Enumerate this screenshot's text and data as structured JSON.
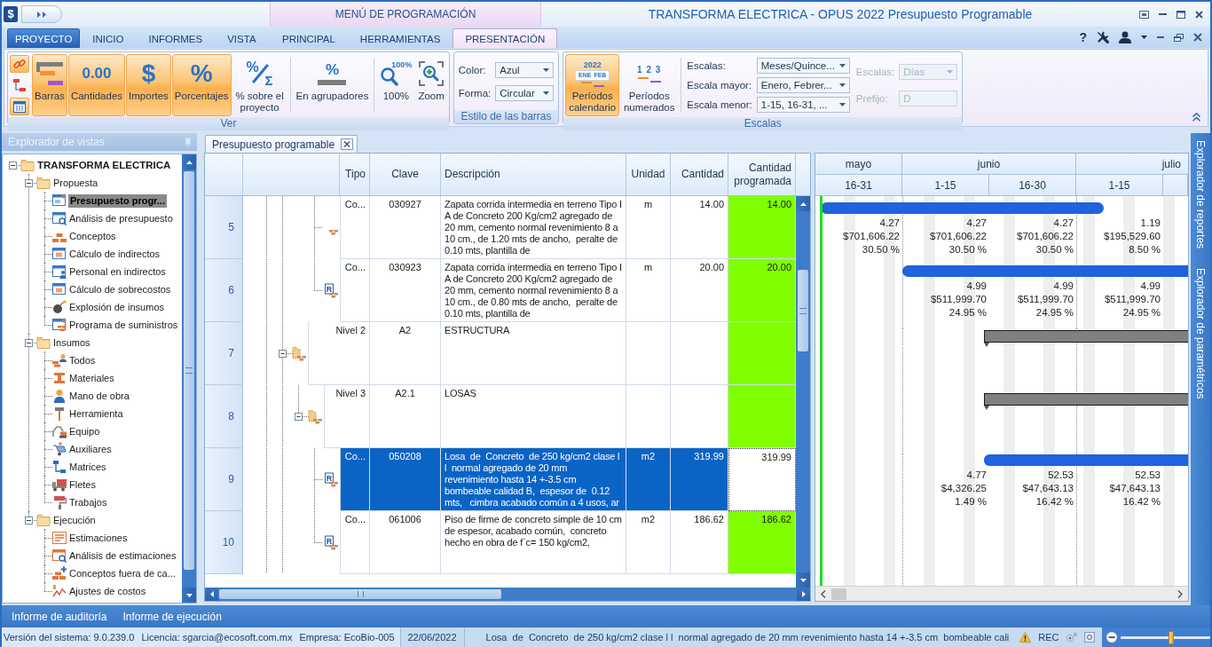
{
  "title_bar": {
    "app_icon": "$",
    "context_header": "MENÚ DE PROGRAMACIÓN",
    "title": "TRANSFORMA ELECTRICA - OPUS 2022 Presupuesto Programable"
  },
  "ribbon_tabs": [
    {
      "label": "PROYECTO",
      "kind": "app",
      "selected": false
    },
    {
      "label": "INICIO",
      "kind": "tab",
      "selected": false
    },
    {
      "label": "INFORMES",
      "kind": "tab",
      "selected": false
    },
    {
      "label": "VISTA",
      "kind": "tab",
      "selected": false
    },
    {
      "label": "PRINCIPAL",
      "kind": "context",
      "selected": false
    },
    {
      "label": "HERRAMIENTAS",
      "kind": "context",
      "selected": false
    },
    {
      "label": "PRESENTACIÓN",
      "kind": "context",
      "selected": true
    }
  ],
  "help": "?",
  "ribbon_groups": [
    {
      "label": "Ver",
      "sections": [
        {
          "kind": "small_buttons",
          "items": [
            {
              "on": true
            },
            {
              "on": false
            },
            {
              "on": true
            }
          ]
        },
        {
          "kind": "large_buttons",
          "items": [
            {
              "label": "Barras",
              "on": true
            },
            {
              "label": "Cantidades",
              "on": true,
              "glyphs": [
                "0.00"
              ]
            },
            {
              "label": "Importes",
              "on": true,
              "glyphs": [
                "$"
              ]
            },
            {
              "label": "Porcentajes",
              "on": true,
              "glyphs": [
                "%"
              ]
            },
            {
              "label": "% sobre el proyecto",
              "on": false,
              "glyphs": [
                "%",
                "Σ"
              ]
            }
          ]
        },
        {
          "kind": "large_buttons",
          "items": [
            {
              "label": "En agrupadores",
              "on": false,
              "glyphs": [
                "%"
              ]
            }
          ]
        },
        {
          "kind": "large_buttons",
          "items": [
            {
              "label": "100%",
              "on": false,
              "glyphs": [
                "100%"
              ]
            },
            {
              "label": "Zoom",
              "on": false
            }
          ]
        }
      ]
    },
    {
      "label": "Estilo de las barras",
      "sections": [
        {
          "kind": "fields",
          "items": [
            {
              "label": "Color:",
              "value": "Azul",
              "kind": "dropdown",
              "disabled": false
            },
            {
              "label": "Forma:",
              "value": "Circular",
              "kind": "dropdown",
              "disabled": false
            }
          ]
        }
      ]
    },
    {
      "label": "Escalas",
      "sections": [
        {
          "kind": "large_buttons",
          "items": [
            {
              "label": "Períodos calendario",
              "on": true,
              "glyphs": [
                "2022",
                "ENE",
                "FEB"
              ]
            },
            {
              "label": "Períodos numerados",
              "on": false,
              "glyphs": [
                "1 2 3"
              ]
            }
          ]
        },
        {
          "kind": "fields",
          "items": [
            {
              "label": "Escalas:",
              "value": "Meses/Quince...",
              "kind": "dropdown",
              "disabled": false
            },
            {
              "label": "Escala mayor:",
              "value": "Enero, Febrer...",
              "kind": "dropdown",
              "disabled": false
            },
            {
              "label": "Escala menor:",
              "value": "1-15, 16-31, ...",
              "kind": "dropdown",
              "disabled": false
            }
          ]
        },
        {
          "kind": "fields",
          "items": [
            {
              "label": "Escalas:",
              "value": "Días",
              "kind": "dropdown",
              "disabled": true
            },
            {
              "label": "Prefijo:",
              "value": "D",
              "kind": "text",
              "disabled": true
            }
          ]
        }
      ]
    }
  ],
  "views_explorer": {
    "title": "Explorador de vistas",
    "tree": [
      {
        "label": "TRANSFORMA ELECTRICA",
        "expanded": true,
        "selected": false,
        "children": [
          {
            "label": "Propuesta",
            "expanded": true,
            "selected": false,
            "children": [
              {
                "label": "Presupuesto progr...",
                "selected": true
              },
              {
                "label": "Análisis de presupuesto",
                "selected": false
              },
              {
                "label": "Conceptos",
                "selected": false
              },
              {
                "label": "Cálculo de indirectos",
                "selected": false
              },
              {
                "label": "Personal en indirectos",
                "selected": false
              },
              {
                "label": "Cálculo de sobrecostos",
                "selected": false
              },
              {
                "label": "Explosión de insumos",
                "selected": false
              },
              {
                "label": "Programa de suministros",
                "selected": false
              }
            ]
          },
          {
            "label": "Insumos",
            "expanded": true,
            "selected": false,
            "children": [
              {
                "label": "Todos",
                "selected": false
              },
              {
                "label": "Materiales",
                "selected": false
              },
              {
                "label": "Mano de obra",
                "selected": false
              },
              {
                "label": "Herramienta",
                "selected": false
              },
              {
                "label": "Equipo",
                "selected": false
              },
              {
                "label": "Auxiliares",
                "selected": false
              },
              {
                "label": "Matrices",
                "selected": false
              },
              {
                "label": "Fletes",
                "selected": false
              },
              {
                "label": "Trabajos",
                "selected": false
              }
            ]
          },
          {
            "label": "Ejecución",
            "expanded": true,
            "selected": false,
            "children": [
              {
                "label": "Estimaciones",
                "selected": false
              },
              {
                "label": "Análisis de estimaciones",
                "selected": false
              },
              {
                "label": "Conceptos fuera de ca...",
                "selected": false
              },
              {
                "label": "Ajustes de costos",
                "selected": false
              }
            ]
          }
        ]
      }
    ]
  },
  "doc_tabs": [
    {
      "label": "Presupuesto programable",
      "selected": true
    }
  ],
  "table": {
    "columns": [
      "Tipo",
      "Clave",
      "Descripción",
      "Unidad",
      "Cantidad",
      "Cantidad programada"
    ],
    "rows": [
      {
        "number": "5",
        "kind": "concepto",
        "selected": false,
        "tipo": "Co...",
        "clave": "030927",
        "descripcion": "Zapata corrida intermedia en terreno Tipo I A de Concreto 200 Kg/cm2 agregado de 20 mm, cemento normal revenimiento 8 a 10 cm., de 1.20 mts de ancho,  peralte de 0.10 mts, plantilla de",
        "unidad": "m",
        "cantidad": "14.00",
        "cantidad_programada": "14.00",
        "schedule": {
          "bar": {
            "kind": "task",
            "continues": false
          },
          "cells": [
            {
              "level": 0.94,
              "quantity": "4.27",
              "amount": "$701,606.22",
              "percent": "30.50 %"
            },
            {
              "level": 1,
              "quantity": "4.27",
              "amount": "$701,606.22",
              "percent": "30.50 %"
            },
            {
              "level": 1,
              "quantity": "4.27",
              "amount": "$701,606.22",
              "percent": "30.50 %"
            },
            {
              "level": 0.32,
              "quantity": "1.19",
              "amount": "$195,529.60",
              "percent": "8.50 %"
            }
          ]
        }
      },
      {
        "number": "6",
        "kind": "concepto",
        "badge": "R",
        "selected": false,
        "tipo": "Co...",
        "clave": "030923",
        "descripcion": "Zapata corrida intermedia en terreno Tipo I A de Concreto 200 Kg/cm2 agregado de 20 mm, cemento normal revenimiento 8 a 10 cm., de 0.80 mts de ancho,  peralte de 0.10 mts, plantilla de",
        "unidad": "m",
        "cantidad": "20.00",
        "cantidad_programada": "20.00",
        "schedule": {
          "bar": {
            "kind": "task",
            "continues": true
          },
          "cells": [
            null,
            {
              "level": 1,
              "quantity": "4.99",
              "amount": "$511,999.70",
              "percent": "24.95 %"
            },
            {
              "level": 1,
              "quantity": "4.99",
              "amount": "$511,999.70",
              "percent": "24.95 %"
            },
            {
              "level": 1,
              "quantity": "4.99",
              "amount": "$511,999.70",
              "percent": "24.95 %"
            }
          ]
        }
      },
      {
        "number": "7",
        "kind": "agrupador",
        "expanded": true,
        "selected": false,
        "tipo": "Nivel 2",
        "clave": "A2",
        "descripcion": "ESTRUCTURA",
        "schedule": {
          "bar": {
            "kind": "summary",
            "continues": true
          },
          "cells": [
            null,
            {
              "level": 0.06
            },
            {
              "level": 1
            },
            {
              "level": 1
            }
          ]
        },
        "children": [
          {
            "number": "8",
            "kind": "agrupador",
            "expanded": true,
            "selected": false,
            "tipo": "Nivel 3",
            "clave": "A2.1",
            "descripcion": "LOSAS",
            "schedule": {
              "bar": {
                "kind": "summary",
                "continues": true
              },
              "cells": [
                null,
                {
                  "level": 0.06
                },
                {
                  "level": 1
                },
                {
                  "level": 1
                }
              ]
            },
            "children": [
              {
                "number": "9",
                "kind": "concepto",
                "badge": "R",
                "selected": true,
                "tipo": "Co...",
                "clave": "050208",
                "descripcion": "Losa  de  Concreto  de 250 kg/cm2 clase l l  normal agregado de 20 mm revenimiento hasta 14 +-3.5 cm bombeable calidad B,  espesor de  0.12 mts,   cimbra acabado común a 4 usos, ar",
                "unidad": "m2",
                "cantidad": "319.99",
                "cantidad_programada": "319.99",
                "schedule": {
                  "bar": {
                    "kind": "task",
                    "continues": true
                  },
                  "cells": [
                    null,
                    {
                      "level": 0.06,
                      "quantity": "4.77",
                      "amount": "$4,326.25",
                      "percent": "1.49 %"
                    },
                    {
                      "level": 1,
                      "quantity": "52.53",
                      "amount": "$47,643.13",
                      "percent": "16.42 %"
                    },
                    {
                      "level": 1,
                      "quantity": "52.53",
                      "amount": "$47,643.13",
                      "percent": "16.42 %"
                    }
                  ]
                }
              },
              {
                "number": "10",
                "kind": "concepto",
                "badge": "R",
                "selected": false,
                "tipo": "Co...",
                "clave": "061006",
                "descripcion": "Piso de firme de concreto simple de 10 cm de espesor, acabado común,  concreto hecho en obra de f`c= 150 kg/cm2,",
                "unidad": "m2",
                "cantidad": "186.62",
                "cantidad_programada": "186.62"
              }
            ]
          }
        ]
      }
    ]
  },
  "gantt": {
    "months": [
      {
        "label": "mayo",
        "periods": [
          "16-31"
        ]
      },
      {
        "label": "junio",
        "periods": [
          "1-15",
          "16-30"
        ]
      },
      {
        "label": "julio",
        "periods": [
          "1-15"
        ]
      }
    ]
  },
  "side_tabs": [
    {
      "label": "Explorador de reportes"
    },
    {
      "label": "Explorador de paramétricos"
    }
  ],
  "bottom_tabs": [
    {
      "label": "Informe de auditoría"
    },
    {
      "label": "Informe de ejecución"
    }
  ],
  "status_bar": {
    "version": "Versión del sistema: 9.0.239.0",
    "license": "Licencia: sgarcia@ecosoft.com.mx",
    "company": "Empresa: EcoBio-005",
    "date": "22/06/2022",
    "description": "Losa  de  Concreto  de 250 kg/cm2 clase l l  normal agregado de 20 mm revenimiento hasta 14 +-3.5 cm  bombeable cali",
    "recording": "REC",
    "zoom": {
      "level": 0.5
    }
  }
}
